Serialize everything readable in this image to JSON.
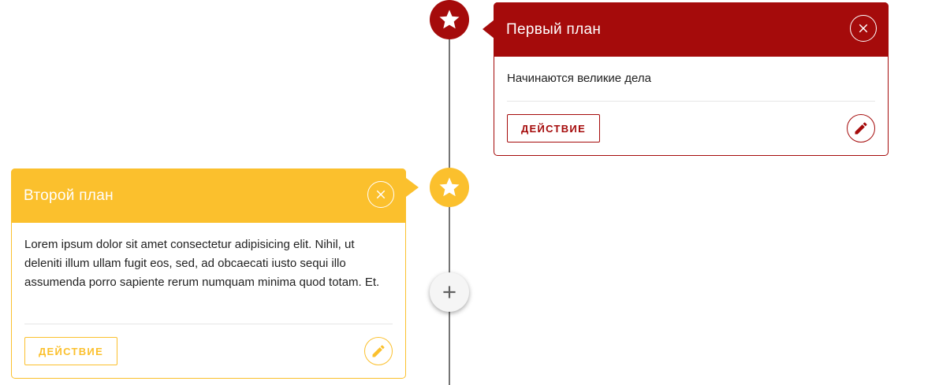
{
  "colors": {
    "primary": "#a50b0b",
    "secondary": "#fbc02d",
    "line": "#757575",
    "add_button_bg": "#f5f5f5",
    "add_icon": "#616161"
  },
  "timeline": {
    "items": [
      {
        "title": "Первый план",
        "body": "Начинаются великие дела",
        "action_label": "ДЕЙСТВИЕ",
        "node_icon": "star-icon",
        "close_icon": "close-icon",
        "edit_icon": "pencil-icon",
        "color": "#a50b0b"
      },
      {
        "title": "Второй план",
        "body": "Lorem ipsum dolor sit amet consectetur adipisicing elit. Nihil, ut deleniti illum ullam fugit eos, sed, ad obcaecati iusto sequi illo assumenda porro sapiente rerum numquam minima quod totam. Et.",
        "action_label": "ДЕЙСТВИЕ",
        "node_icon": "star-icon",
        "close_icon": "close-icon",
        "edit_icon": "pencil-icon",
        "color": "#fbc02d"
      }
    ],
    "add_button_icon": "plus-icon"
  }
}
